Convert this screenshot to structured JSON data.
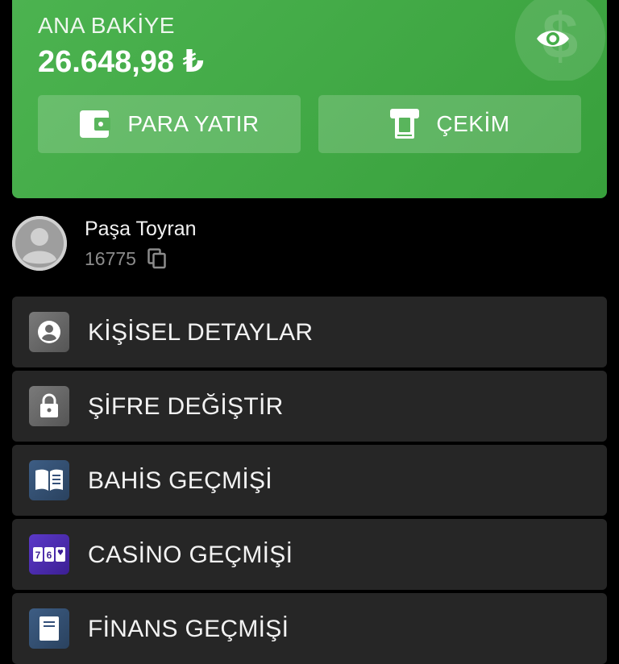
{
  "balance": {
    "label": "ANA BAKİYE",
    "amount": "26.648,98 ₺",
    "deposit_label": "PARA YATIR",
    "withdraw_label": "ÇEKİM",
    "accent": "#43ad47"
  },
  "profile": {
    "name": "Paşa Toyran",
    "id": "16775"
  },
  "menu": {
    "items": [
      {
        "label": "KİŞİSEL DETAYLAR",
        "icon": "account-circle-icon"
      },
      {
        "label": "ŞİFRE DEĞİŞTİR",
        "icon": "lock-icon"
      },
      {
        "label": "BAHİS GEÇMİŞİ",
        "icon": "book-icon"
      },
      {
        "label": "CASİNO GEÇMİŞİ",
        "icon": "slot-machine-icon"
      },
      {
        "label": "FİNANS GEÇMİŞİ",
        "icon": "receipt-icon"
      }
    ]
  }
}
